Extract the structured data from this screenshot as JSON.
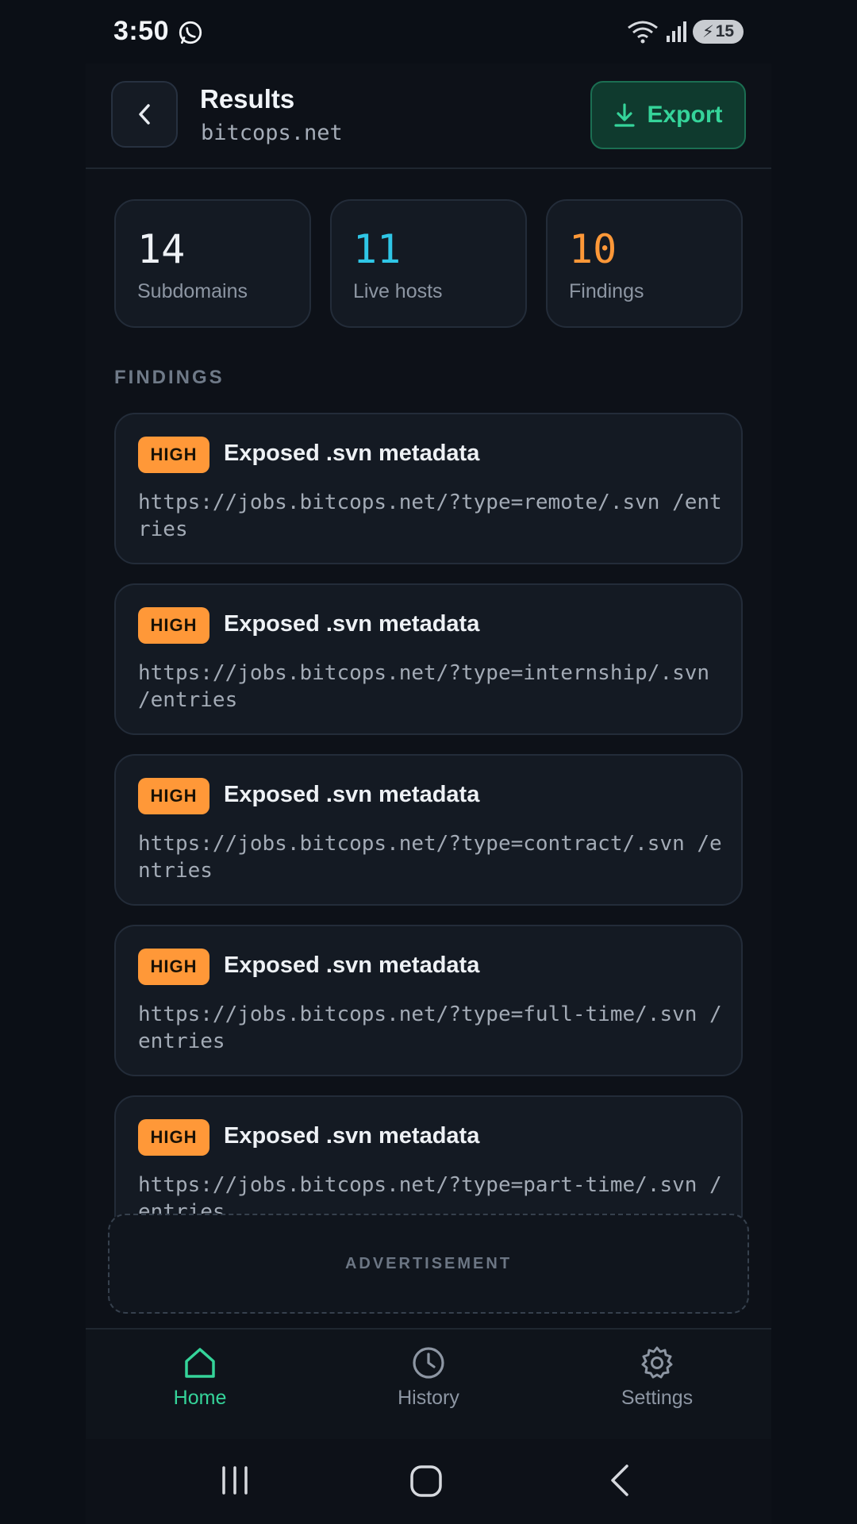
{
  "status_bar": {
    "time": "3:50",
    "battery": "15",
    "icons": [
      "whatsapp-icon",
      "wifi-icon",
      "signal-icon",
      "battery-icon"
    ]
  },
  "header": {
    "title": "Results",
    "domain": "bitcops.net",
    "export_label": "Export"
  },
  "stats": [
    {
      "value": "14",
      "label": "Subdomains",
      "color": "#eef1f5"
    },
    {
      "value": "11",
      "label": "Live hosts",
      "color": "#2fc6e6"
    },
    {
      "value": "10",
      "label": "Findings",
      "color": "#ff9838"
    }
  ],
  "findings_section_label": "FINDINGS",
  "findings": [
    {
      "severity": "HIGH",
      "title": "Exposed .svn metadata",
      "url": "https://jobs.bitcops.net/?type=remote/.svn /entries"
    },
    {
      "severity": "HIGH",
      "title": "Exposed .svn metadata",
      "url": "https://jobs.bitcops.net/?type=internship/.svn /entries"
    },
    {
      "severity": "HIGH",
      "title": "Exposed .svn metadata",
      "url": "https://jobs.bitcops.net/?type=contract/.svn /entries"
    },
    {
      "severity": "HIGH",
      "title": "Exposed .svn metadata",
      "url": "https://jobs.bitcops.net/?type=full-time/.svn /entries"
    },
    {
      "severity": "HIGH",
      "title": "Exposed .svn metadata",
      "url": "https://jobs.bitcops.net/?type=part-time/.svn /entries"
    }
  ],
  "ad_label": "ADVERTISEMENT",
  "nav": {
    "home": "Home",
    "history": "History",
    "settings": "Settings",
    "active": "home"
  },
  "colors": {
    "accent": "#35d49a",
    "high": "#ff9838",
    "background": "#0d1118"
  }
}
